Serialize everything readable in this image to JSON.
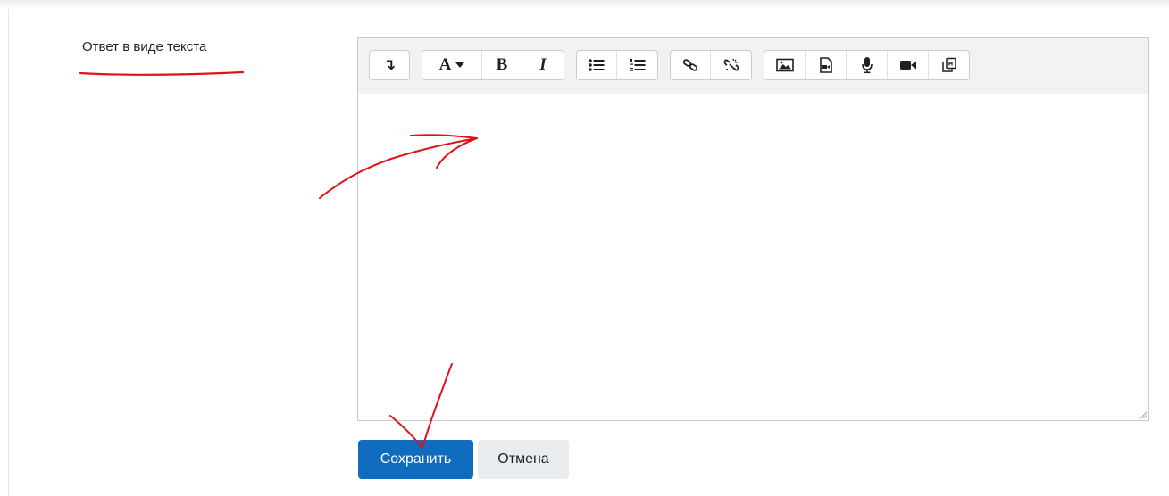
{
  "form": {
    "field_label": "Ответ в виде текста",
    "save_label": "Сохранить",
    "cancel_label": "Отмена"
  },
  "toolbar": {
    "groups": [
      [
        "show-more-icon"
      ],
      [
        "font-style-icon",
        "bold-icon",
        "italic-icon"
      ],
      [
        "unordered-list-icon",
        "ordered-list-icon"
      ],
      [
        "link-icon",
        "unlink-icon"
      ],
      [
        "image-icon",
        "media-icon",
        "record-audio-icon",
        "record-video-icon",
        "h5p-icon"
      ]
    ],
    "font_glyph": "A",
    "bold_glyph": "B",
    "italic_glyph": "I",
    "more_glyph": "↴"
  },
  "colors": {
    "primary": "#0f6cbf",
    "secondary": "#e9ecef",
    "annotation": "#e0111b",
    "toolbar_bg": "#f2f2f2"
  }
}
